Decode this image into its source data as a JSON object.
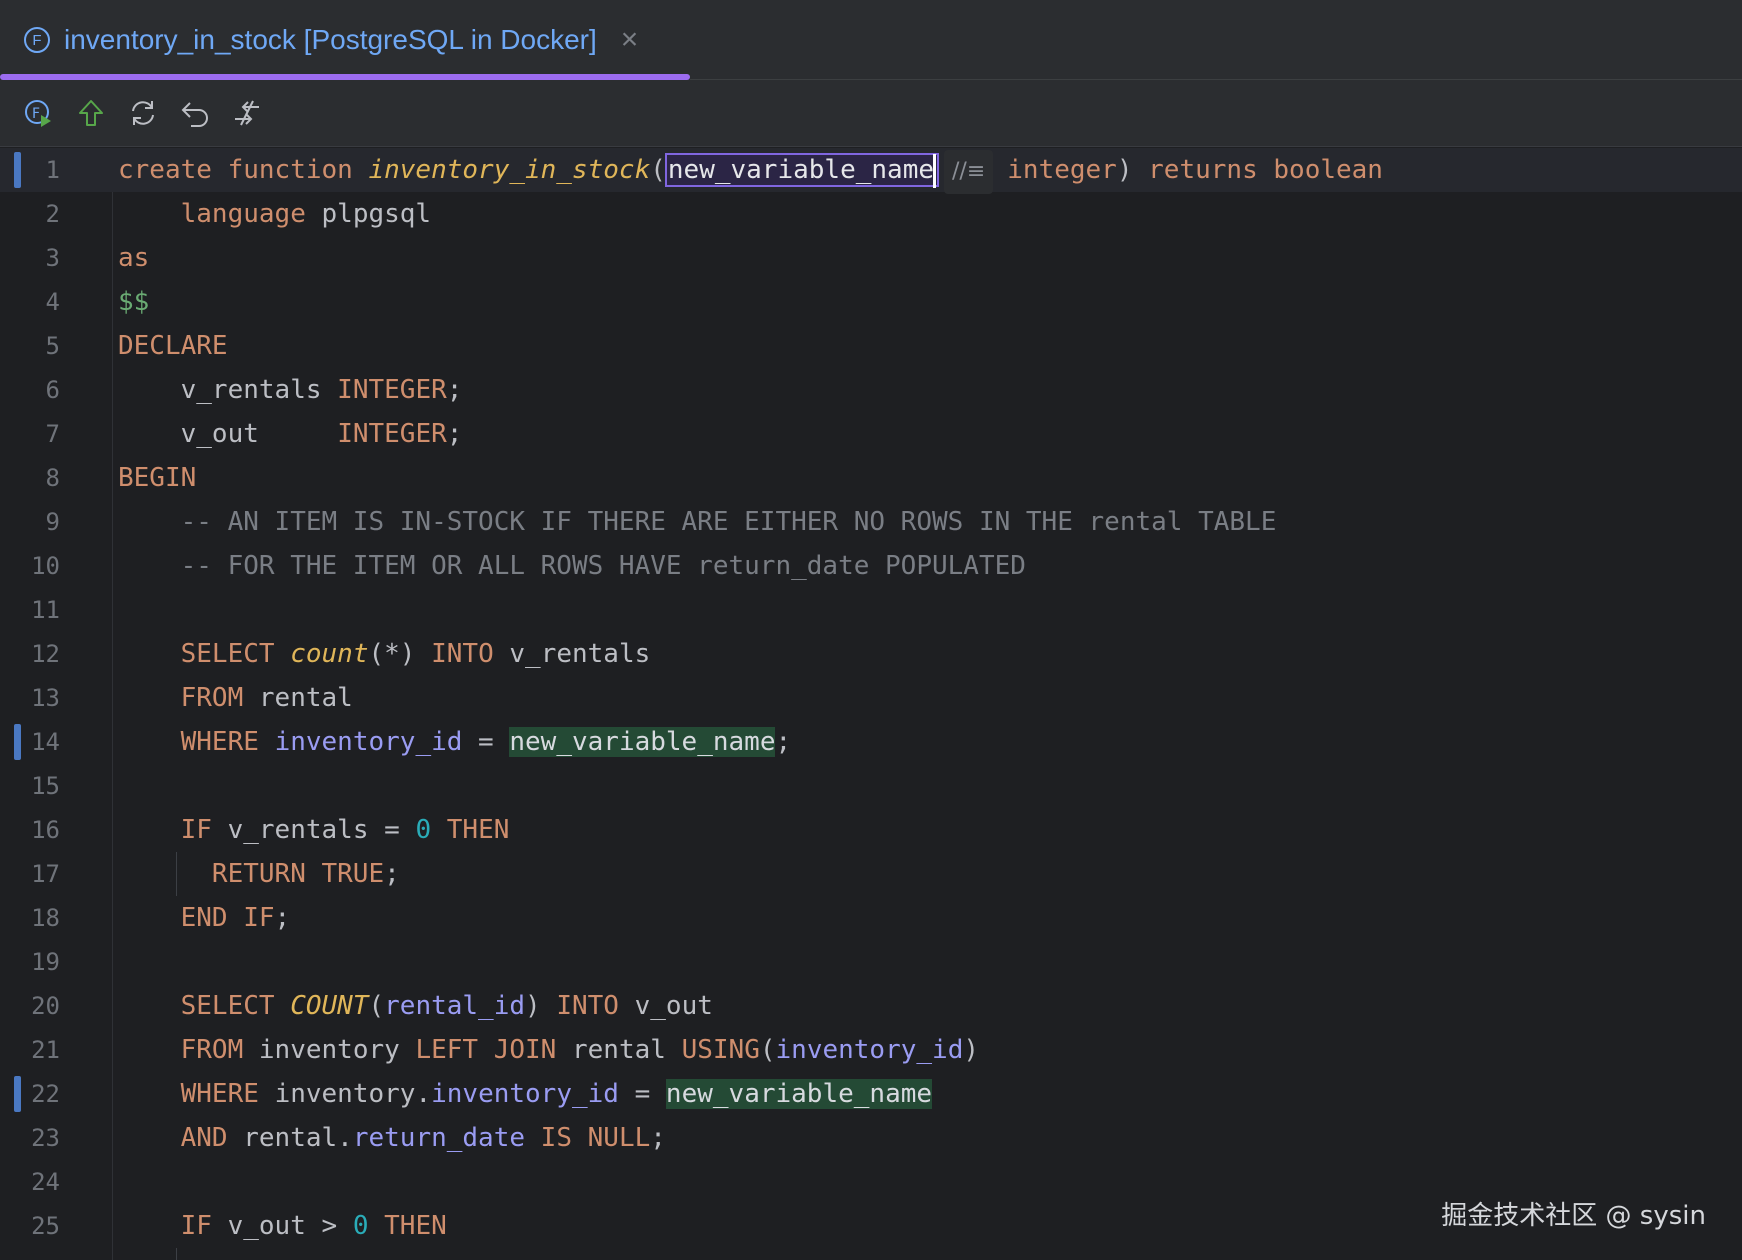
{
  "tab": {
    "file_icon_glyph": "F",
    "title": "inventory_in_stock [PostgreSQL in Docker]",
    "close_glyph": "×"
  },
  "toolbar": {
    "icons": [
      "run-function-icon",
      "submit-arrow-up-icon",
      "refresh-icon",
      "revert-icon",
      "compare-icon"
    ]
  },
  "editor": {
    "inlay_hint": "//≡",
    "lines": [
      {
        "number": "1"
      },
      {
        "number": "2"
      },
      {
        "number": "3"
      },
      {
        "number": "4"
      },
      {
        "number": "5"
      },
      {
        "number": "6"
      },
      {
        "number": "7"
      },
      {
        "number": "8"
      },
      {
        "number": "9"
      },
      {
        "number": "10"
      },
      {
        "number": "11"
      },
      {
        "number": "12"
      },
      {
        "number": "13"
      },
      {
        "number": "14"
      },
      {
        "number": "15"
      },
      {
        "number": "16"
      },
      {
        "number": "17"
      },
      {
        "number": "18"
      },
      {
        "number": "19"
      },
      {
        "number": "20"
      },
      {
        "number": "21"
      },
      {
        "number": "22"
      },
      {
        "number": "23"
      },
      {
        "number": "24"
      },
      {
        "number": "25"
      }
    ],
    "tokens": {
      "create": "create",
      "function": "function",
      "fn_name": "inventory_in_stock",
      "param": "new_variable_name",
      "integer": "integer",
      "returns": "returns",
      "boolean": "boolean",
      "language": "language",
      "plpgsql": "plpgsql",
      "as": "as",
      "dollar": "$$",
      "declare": "DECLARE",
      "v_rentals": "v_rentals",
      "v_out": "v_out",
      "INTEGER": "INTEGER",
      "begin": "BEGIN",
      "comment1": "-- AN ITEM IS IN-STOCK IF THERE ARE EITHER NO ROWS IN THE rental TABLE",
      "comment2": "-- FOR THE ITEM OR ALL ROWS HAVE return_date POPULATED",
      "select": "SELECT",
      "count": "count",
      "COUNT": "COUNT",
      "star": "(*)",
      "into": "INTO",
      "from": "FROM",
      "rental": "rental",
      "where": "WHERE",
      "inventory_id": "inventory_id",
      "if": "IF",
      "then": "THEN",
      "zero": "0",
      "return": "RETURN",
      "true": "TRUE",
      "end_if": "END IF",
      "rental_id": "rental_id",
      "inventory": "inventory",
      "left_join": "LEFT JOIN",
      "using": "USING",
      "and": "AND",
      "return_date": "return_date",
      "is_null": "IS NULL"
    }
  },
  "watermark": "掘金技术社区 @ sysin",
  "colors": {
    "keyword": "#cf8e6d",
    "function": "#e0b659",
    "column": "#9a9cf2",
    "number": "#2aacb8",
    "comment": "#7a7e85",
    "dollar_quote": "#6aab73",
    "accent": "#9c6cf0",
    "reference_highlight": "#244a35"
  }
}
